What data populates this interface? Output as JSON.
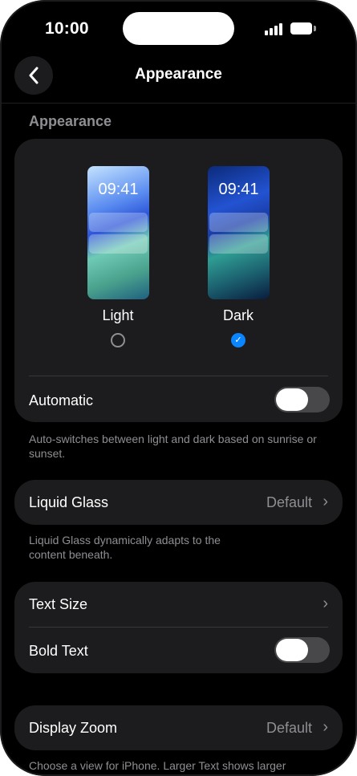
{
  "status": {
    "time": "10:00"
  },
  "nav": {
    "title": "Appearance"
  },
  "appearance": {
    "header": "Appearance",
    "light": {
      "preview_time": "09:41",
      "label": "Light",
      "selected": false
    },
    "dark": {
      "preview_time": "09:41",
      "label": "Dark",
      "selected": true
    },
    "automatic_label": "Automatic",
    "automatic_on": false,
    "footnote": "Auto-switches between light and dark based on sunrise or sunset."
  },
  "liquid_glass": {
    "label": "Liquid Glass",
    "value": "Default",
    "footnote": "Liquid Glass dynamically adapts to the content beneath."
  },
  "text": {
    "text_size_label": "Text Size",
    "bold_text_label": "Bold Text",
    "bold_text_on": false
  },
  "display_zoom": {
    "label": "Display Zoom",
    "value": "Default",
    "footnote": "Choose a view for iPhone. Larger Text shows larger"
  },
  "colors": {
    "accent": "#0a84ff",
    "card": "#1c1c1e",
    "secondary_text": "#8e8e93"
  }
}
